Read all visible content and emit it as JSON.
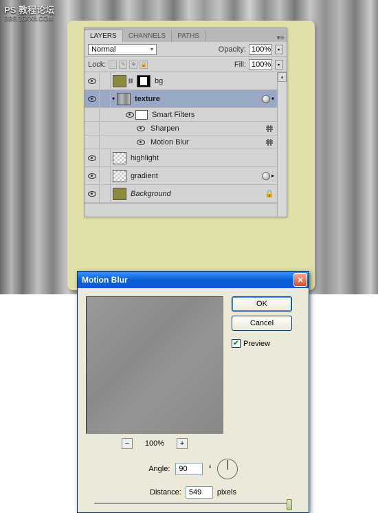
{
  "watermark": {
    "title": "PS 教程论坛",
    "url": "BBS.16XX8.COM"
  },
  "panel": {
    "tabs": [
      "LAYERS",
      "CHANNELS",
      "PATHS"
    ],
    "blend_mode": "Normal",
    "opacity_label": "Opacity:",
    "opacity_value": "100%",
    "lock_label": "Lock:",
    "fill_label": "Fill:",
    "fill_value": "100%",
    "layers": {
      "bg": "bg",
      "texture": "texture",
      "smart_filters": "Smart Filters",
      "sharpen": "Sharpen",
      "motion_blur": "Motion Blur",
      "highlight": "highlight",
      "gradient": "gradient",
      "background": "Background"
    }
  },
  "dialog": {
    "title": "Motion Blur",
    "ok": "OK",
    "cancel": "Cancel",
    "preview": "Preview",
    "zoom": "100%",
    "angle_label": "Angle:",
    "angle_value": "90",
    "angle_unit": "°",
    "distance_label": "Distance:",
    "distance_value": "549",
    "distance_unit": "pixels"
  }
}
